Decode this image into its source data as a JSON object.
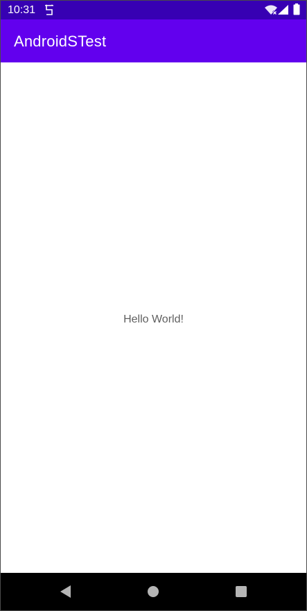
{
  "status_bar": {
    "time": "10:31",
    "app_icon": "s-notification-icon",
    "wifi_icon": "wifi-no-internet-icon",
    "signal_icon": "cell-signal-icon",
    "battery_icon": "battery-icon",
    "background": "#3700b3"
  },
  "app_bar": {
    "title": "AndroidSTest",
    "background": "#6200ee"
  },
  "content": {
    "text": "Hello World!"
  },
  "nav_bar": {
    "back_icon": "back-triangle-icon",
    "home_icon": "home-circle-icon",
    "recents_icon": "recents-square-icon",
    "background": "#000000"
  }
}
